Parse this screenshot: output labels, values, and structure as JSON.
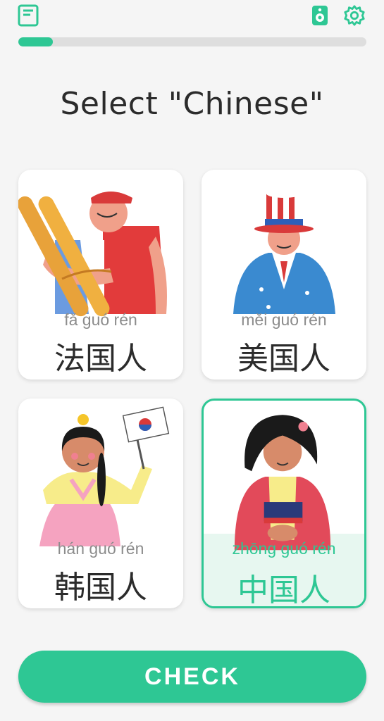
{
  "header": {
    "book_icon": "book-icon",
    "speaker_icon": "speaker-icon",
    "settings_icon": "gear-icon"
  },
  "progress": {
    "fraction": 0.1
  },
  "prompt": "Select \"Chinese\"",
  "options": [
    {
      "pinyin": "fǎ guó rén",
      "hanzi": "法国人",
      "selected": false
    },
    {
      "pinyin": "měi guó rén",
      "hanzi": "美国人",
      "selected": false
    },
    {
      "pinyin": "hán guó rén",
      "hanzi": "韩国人",
      "selected": false
    },
    {
      "pinyin": "zhōng guó rén",
      "hanzi": "中国人",
      "selected": true
    }
  ],
  "check_label": "CHECK",
  "colors": {
    "accent": "#2ec794",
    "selected_bg": "#e7f7f0",
    "text": "#2b2b2b",
    "pinyin": "#8c8c8c",
    "background": "#f5f5f5"
  }
}
